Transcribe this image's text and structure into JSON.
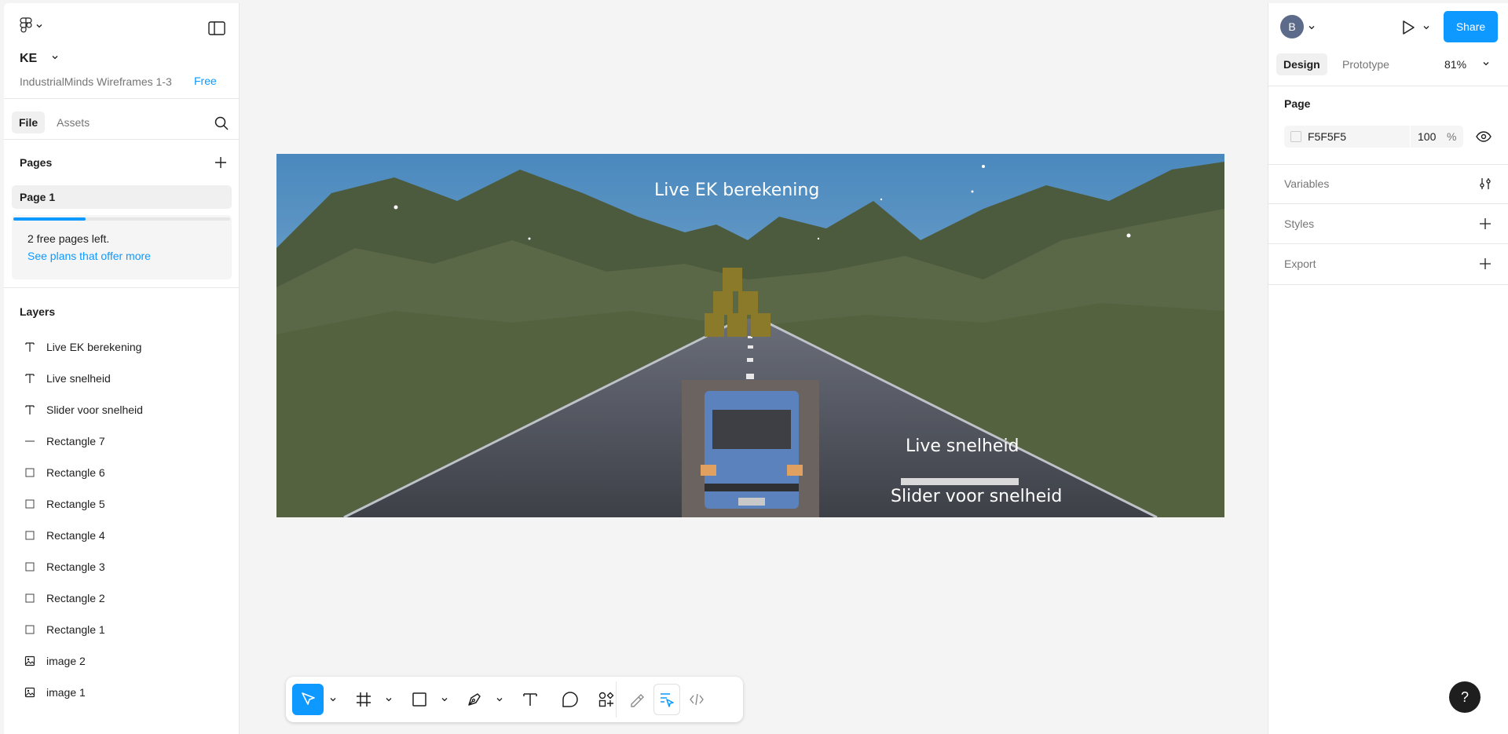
{
  "file": {
    "title": "KE",
    "subtitle": "IndustrialMinds Wireframes 1-3",
    "plan_badge": "Free"
  },
  "left_tabs": [
    {
      "label": "File",
      "active": true
    },
    {
      "label": "Assets",
      "active": false
    }
  ],
  "pages": {
    "section_label": "Pages",
    "items": [
      {
        "label": "Page 1"
      }
    ],
    "upsell": {
      "progress_fraction": 0.333,
      "text": "2 free pages left.",
      "link": "See plans that offer more"
    }
  },
  "layers": {
    "section_label": "Layers",
    "items": [
      {
        "label": "Live EK berekening",
        "icon": "text-icon"
      },
      {
        "label": "Live snelheid",
        "icon": "text-icon"
      },
      {
        "label": "Slider voor snelheid",
        "icon": "text-icon"
      },
      {
        "label": "Rectangle 7",
        "icon": "line-icon"
      },
      {
        "label": "Rectangle 6",
        "icon": "rectangle-icon"
      },
      {
        "label": "Rectangle 5",
        "icon": "rectangle-icon"
      },
      {
        "label": "Rectangle 4",
        "icon": "rectangle-icon"
      },
      {
        "label": "Rectangle 3",
        "icon": "rectangle-icon"
      },
      {
        "label": "Rectangle 2",
        "icon": "rectangle-icon"
      },
      {
        "label": "Rectangle 1",
        "icon": "rectangle-icon"
      },
      {
        "label": "image 2",
        "icon": "image-icon"
      },
      {
        "label": "image 1",
        "icon": "image-icon"
      }
    ]
  },
  "right": {
    "avatar_initial": "B",
    "share_label": "Share",
    "tabs": [
      {
        "label": "Design",
        "active": true
      },
      {
        "label": "Prototype",
        "active": false
      }
    ],
    "zoom": "81%",
    "page_section": {
      "label": "Page",
      "color_hex": "F5F5F5",
      "opacity": "100",
      "opacity_unit": "%"
    },
    "variables_label": "Variables",
    "styles_label": "Styles",
    "export_label": "Export"
  },
  "canvas": {
    "frame_texts": {
      "heading": "Live EK berekening",
      "speed": "Live snelheid",
      "slider": "Slider voor snelheid"
    }
  },
  "toolbar": {
    "tools": [
      "move-tool",
      "frame-tool",
      "rectangle-tool",
      "pen-tool",
      "text-tool",
      "comment-tool",
      "actions-tool"
    ],
    "right_tools": [
      "draw-mode",
      "design-mode",
      "dev-mode"
    ]
  },
  "help_label": "?",
  "colors": {
    "accent": "#0d99ff",
    "panel_bg": "#ffffff",
    "canvas_bg": "#f4f4f4",
    "page_color": "#F5F5F5"
  }
}
